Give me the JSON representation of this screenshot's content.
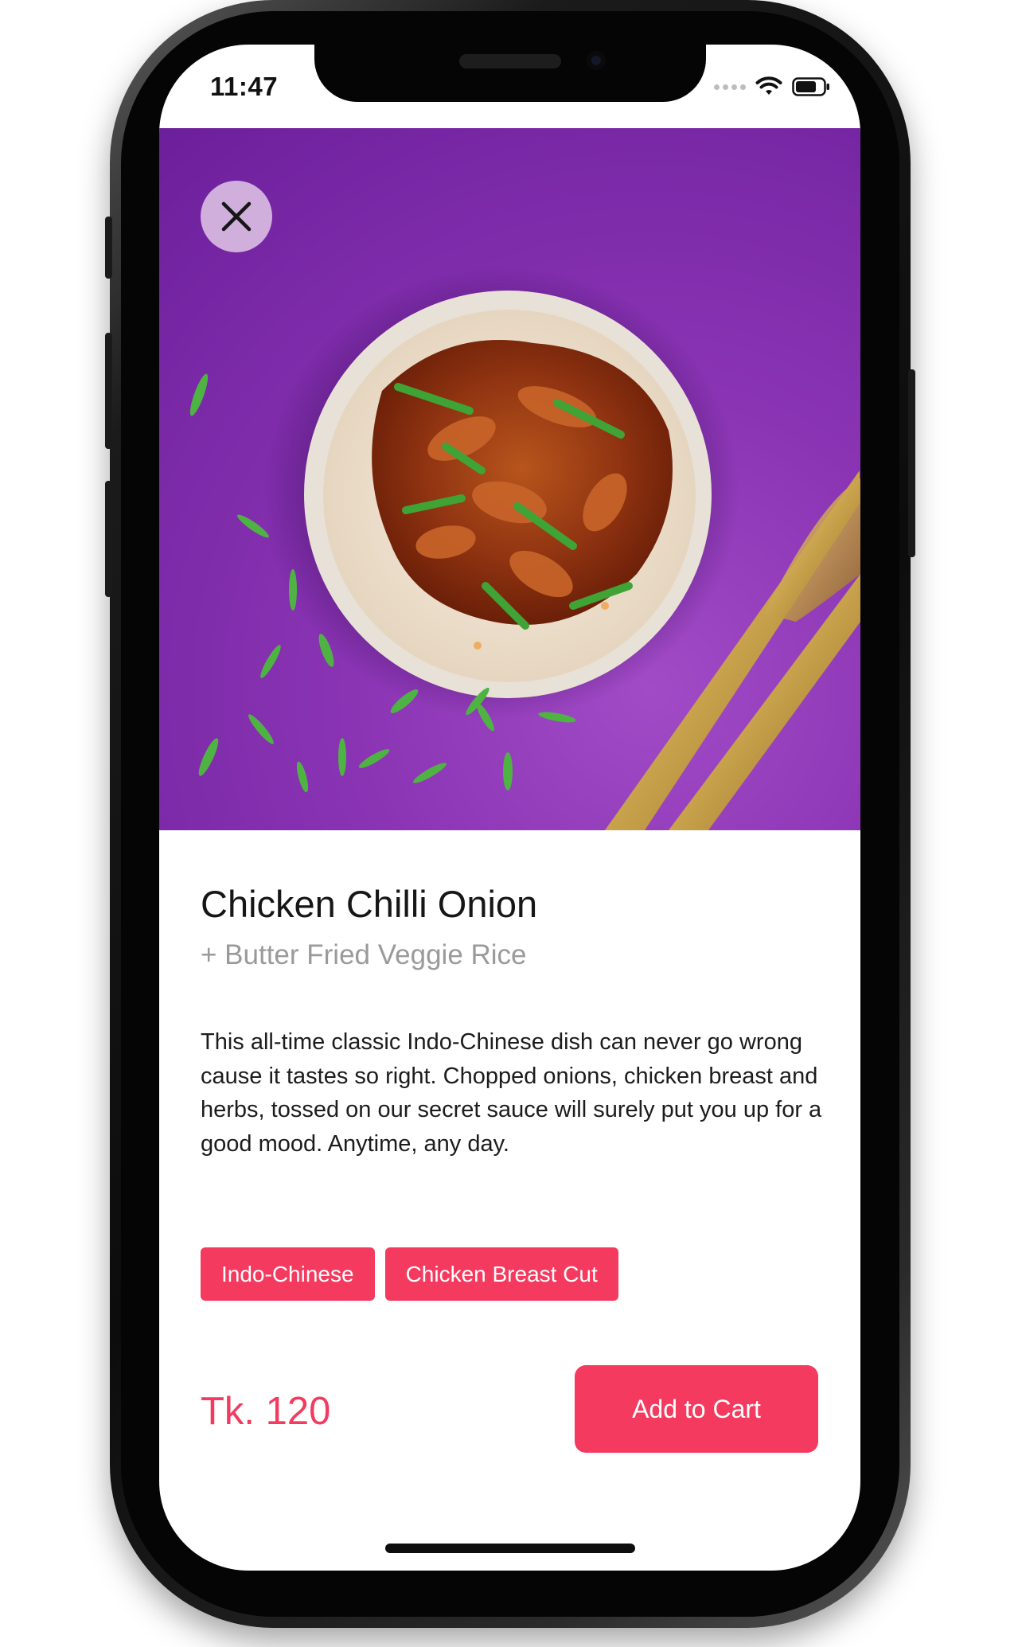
{
  "status_bar": {
    "time": "11:47",
    "icons": [
      "signal-dots-icon",
      "wifi-icon",
      "battery-icon"
    ]
  },
  "hero": {
    "image": "chicken-chilli-onion-bowl-photo",
    "background_color": "#8a34b4",
    "close_icon": "close-icon"
  },
  "dish": {
    "title": "Chicken Chilli Onion",
    "subtitle": "+ Butter Fried Veggie Rice",
    "description": "This all-time classic Indo-Chinese dish can never go wrong cause it tastes so right. Chopped onions, chicken breast and herbs, tossed on our secret sauce will surely put you up for a good mood. Anytime, any day.",
    "tags": [
      "Indo-Chinese",
      "Chicken Breast Cut"
    ]
  },
  "footer": {
    "price": "Tk. 120",
    "add_to_cart_label": "Add to Cart"
  },
  "colors": {
    "accent": "#f43a5e",
    "hero_purple": "#8a34b4",
    "close_button_bg": "#e1c8e8"
  }
}
